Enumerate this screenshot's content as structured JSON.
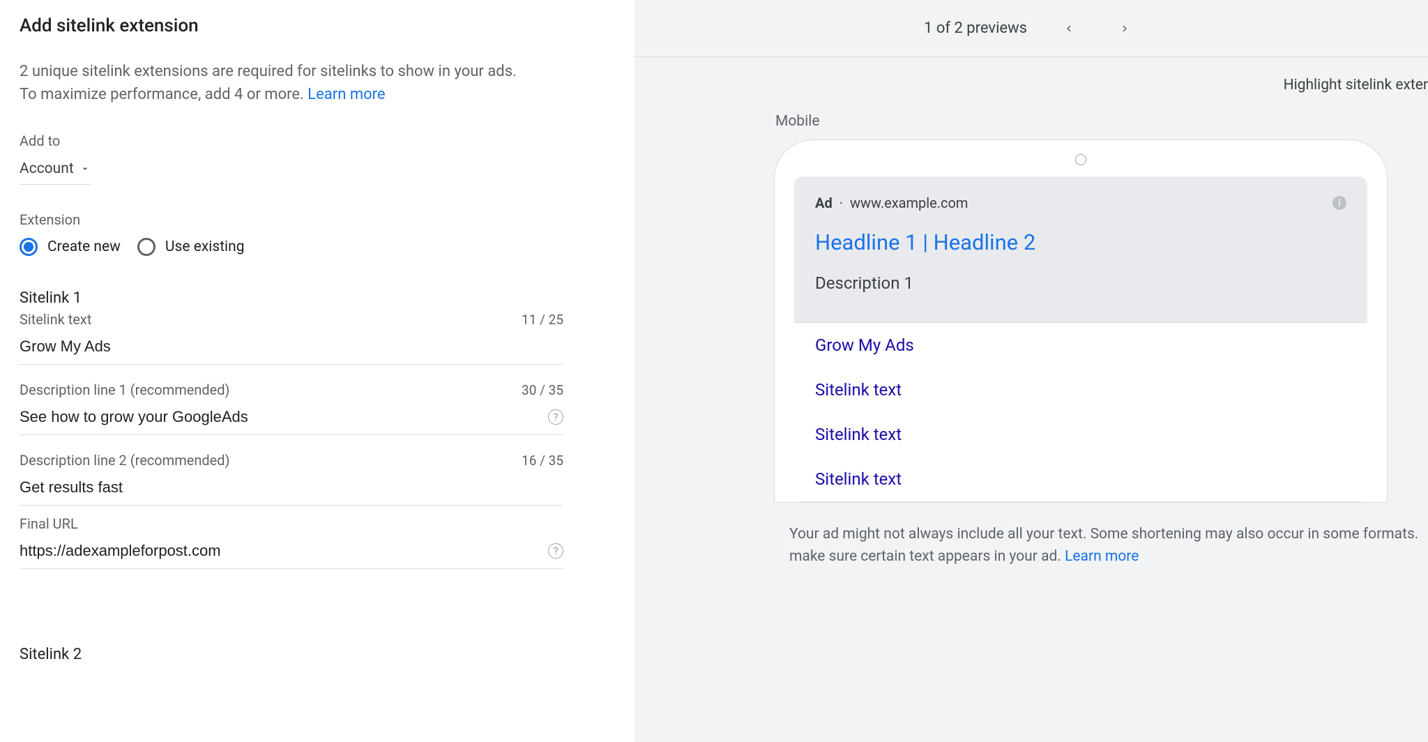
{
  "left": {
    "title": "Add sitelink extension",
    "description": "2 unique sitelink extensions are required for sitelinks to show in your ads. To maximize performance, add 4 or more. ",
    "learn_more": "Learn more",
    "add_to_label": "Add to",
    "add_to_value": "Account",
    "extension_label": "Extension",
    "radio_create": "Create new",
    "radio_existing": "Use existing",
    "sitelink1_heading": "Sitelink 1",
    "sitelink2_heading": "Sitelink 2",
    "fields": {
      "sitelink_text": {
        "label": "Sitelink text",
        "value": "Grow My Ads",
        "counter": "11 / 25"
      },
      "desc1": {
        "label": "Description line 1 (recommended)",
        "value": "See how to grow your GoogleAds",
        "counter": "30 / 35"
      },
      "desc2": {
        "label": "Description line 2 (recommended)",
        "value": "Get results fast",
        "counter": "16 / 35"
      },
      "final_url": {
        "label": "Final URL",
        "value": "https://adexampleforpost.com",
        "counter": ""
      }
    }
  },
  "right": {
    "preview_counter": "1 of 2 previews",
    "highlight_label": "Highlight sitelink exter",
    "device_label": "Mobile",
    "ad": {
      "badge": "Ad",
      "domain": "www.example.com",
      "headline": "Headline 1 | Headline 2",
      "description": "Description 1",
      "sitelinks": [
        "Grow My Ads",
        "Sitelink text",
        "Sitelink text",
        "Sitelink text"
      ]
    },
    "disclaimer": "Your ad might not always include all your text. Some shortening may also occur in some formats. make sure certain text appears in your ad. ",
    "disclaimer_link": "Learn more"
  }
}
